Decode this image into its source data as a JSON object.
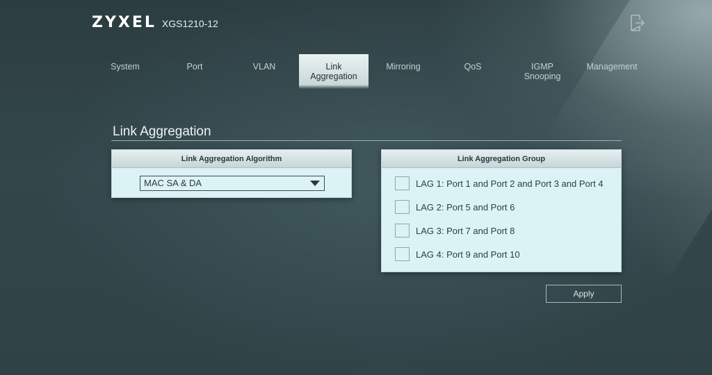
{
  "header": {
    "brand": "ZYXEL",
    "model": "XGS1210-12",
    "logout_icon": "logout-icon"
  },
  "nav": {
    "tabs": [
      {
        "label": "System",
        "active": false
      },
      {
        "label": "Port",
        "active": false
      },
      {
        "label": "VLAN",
        "active": false
      },
      {
        "label": "Link\nAggregation",
        "active": true
      },
      {
        "label": "Mirroring",
        "active": false
      },
      {
        "label": "QoS",
        "active": false
      },
      {
        "label": "IGMP\nSnooping",
        "active": false
      },
      {
        "label": "Management",
        "active": false
      }
    ]
  },
  "page": {
    "title": "Link Aggregation"
  },
  "algorithm_panel": {
    "header": "Link Aggregation Algorithm",
    "select_value": "MAC SA & DA"
  },
  "group_panel": {
    "header": "Link Aggregation Group",
    "lags": [
      {
        "label": "LAG 1: Port 1 and Port 2 and Port 3 and Port 4",
        "checked": false
      },
      {
        "label": "LAG 2: Port 5 and Port 6",
        "checked": false
      },
      {
        "label": "LAG 3: Port 7 and Port 8",
        "checked": false
      },
      {
        "label": "LAG 4: Port 9 and Port 10",
        "checked": false
      }
    ]
  },
  "actions": {
    "apply_label": "Apply"
  },
  "colors": {
    "panel_bg": "#dcf3f6",
    "page_bg": "#33474b",
    "active_tab": "#eaf2f3"
  }
}
